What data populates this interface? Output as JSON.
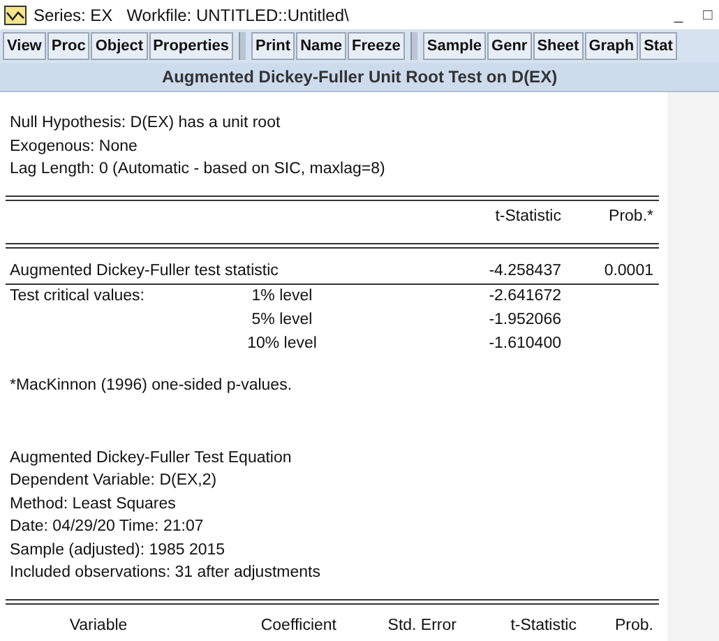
{
  "window": {
    "title": "Series: EX   Workfile: UNTITLED::Untitled\\",
    "controls": [
      "_",
      "□"
    ]
  },
  "toolbar": [
    [
      "View",
      "Proc",
      "Object",
      "Properties"
    ],
    [
      "Print",
      "Name",
      "Freeze"
    ],
    [
      "Sample",
      "Genr",
      "Sheet",
      "Graph",
      "Stat"
    ]
  ],
  "header": "Augmented Dickey-Fuller Unit Root Test on D(EX)",
  "intro": [
    "Null Hypothesis: D(EX) has a unit root",
    "Exogenous: None",
    "Lag Length: 0 (Automatic - based on SIC, maxlag=8)"
  ],
  "test_table": {
    "columns": [
      "t-Statistic",
      "Prob.*"
    ],
    "rows": [
      {
        "label": "Augmented Dickey-Fuller test statistic",
        "level": "",
        "t": "-4.258437",
        "prob": "0.0001"
      },
      {
        "label": "Test critical values:",
        "level": "1% level",
        "t": "-2.641672",
        "prob": ""
      },
      {
        "label": "",
        "level": "5% level",
        "t": "-1.952066",
        "prob": ""
      },
      {
        "label": "",
        "level": "10% level",
        "t": "-1.610400",
        "prob": ""
      }
    ]
  },
  "footnote": "*MacKinnon (1996) one-sided p-values.",
  "equation": [
    "Augmented Dickey-Fuller Test Equation",
    "Dependent Variable: D(EX,2)",
    "Method: Least Squares",
    "Date: 04/29/20   Time: 21:07",
    "Sample (adjusted): 1985 2015",
    "Included observations: 31 after adjustments"
  ],
  "coef_table": {
    "columns": [
      "Variable",
      "Coefficient",
      "Std. Error",
      "t-Statistic",
      "Prob."
    ]
  }
}
